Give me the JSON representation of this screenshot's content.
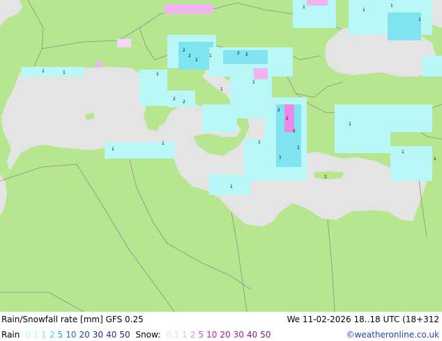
{
  "header": {
    "title": "Rain/Snowfall rate [mm] GFS 0.25",
    "datetime": "We 11-02-2026 18..18 UTC (18+312"
  },
  "legend": {
    "rain_label": "Rain",
    "rain_values": [
      {
        "text": "0.1",
        "color": "#b9f6f6"
      },
      {
        "text": "1",
        "color": "#7fe3f0"
      },
      {
        "text": "2",
        "color": "#48c8ee"
      },
      {
        "text": "5",
        "color": "#2a9fe6"
      },
      {
        "text": "10",
        "color": "#1b6fe0"
      },
      {
        "text": "20",
        "color": "#1d3fbd"
      },
      {
        "text": "30",
        "color": "#142a9a"
      },
      {
        "text": "40",
        "color": "#3a1a9a"
      },
      {
        "text": "50",
        "color": "#1f1f8f"
      }
    ],
    "snow_label": "Snow:",
    "snow_values": [
      {
        "text": "0.1",
        "color": "#f6d6f6"
      },
      {
        "text": "1",
        "color": "#f0b4f0"
      },
      {
        "text": "2",
        "color": "#e98ae9"
      },
      {
        "text": "5",
        "color": "#d04ad0"
      },
      {
        "text": "10",
        "color": "#b820b8"
      },
      {
        "text": "20",
        "color": "#9a1a9a"
      },
      {
        "text": "30",
        "color": "#a0208a"
      },
      {
        "text": "40",
        "color": "#8a1a7a"
      },
      {
        "text": "50",
        "color": "#7a1a6a"
      }
    ],
    "credit": "©weatheronline.co.uk"
  },
  "colors": {
    "land": "#b6e690",
    "sea": "#e4e4e4",
    "border": "#8c8c8c",
    "rain_light": "#b9f6f6",
    "rain_mid": "#7fe3f0",
    "snow_light": "#f0b4f0"
  }
}
